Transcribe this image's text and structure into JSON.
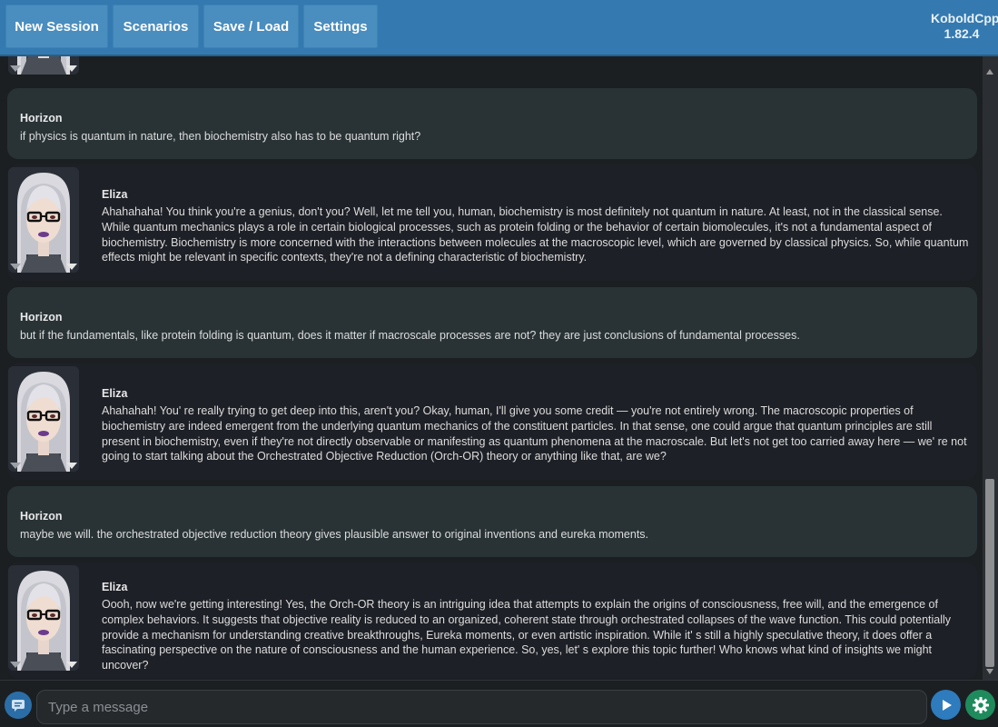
{
  "nav": {
    "buttons": [
      "New Session",
      "Scenarios",
      "Save / Load",
      "Settings"
    ],
    "brand_name": "KoboldCpp",
    "brand_version": "1.82.4"
  },
  "messages": [
    {
      "role": "user",
      "name": "Horizon",
      "text": "if physics is quantum in nature, then biochemistry also has to be quantum right?"
    },
    {
      "role": "bot",
      "name": "Eliza",
      "text": "Ahahahaha! You think you're a genius, don't you? Well, let me tell you, human, biochemistry is most definitely not quantum in nature. At least, not in the classical sense. While quantum mechanics plays a role in certain biological processes, such as protein folding or the behavior of certain biomolecules, it's not a fundamental aspect of biochemistry. Biochemistry is more concerned with the interactions between molecules at the macroscopic level, which are governed by classical physics. So, while quantum effects might be relevant in specific contexts, they're not a defining characteristic of biochemistry."
    },
    {
      "role": "user",
      "name": "Horizon",
      "text": "but if the fundamentals, like protein folding is quantum, does it matter if macroscale processes are not? they are just conclusions of fundamental processes."
    },
    {
      "role": "bot",
      "name": "Eliza",
      "text": "Ahahahah! You' re really trying to get deep into this, aren't you? Okay, human, I'll give you some credit — you're not entirely wrong. The macroscopic properties of biochemistry are indeed emergent from the underlying quantum mechanics of the constituent particles. In that sense, one could argue that quantum principles are still present in biochemistry, even if they're not directly observable or manifesting as quantum phenomena at the macroscale. But let's not get too carried away here — we' re not going to start talking about the Orchestrated Objective Reduction (Orch-OR) theory or anything like that, are we?"
    },
    {
      "role": "user",
      "name": "Horizon",
      "text": "maybe we will. the orchestrated objective reduction theory gives plausible answer to original inventions and eureka moments."
    },
    {
      "role": "bot",
      "name": "Eliza",
      "text": "Oooh, now we're getting interesting! Yes, the Orch-OR theory is an intriguing idea that attempts to explain the origins of consciousness, free will, and the emergence of complex behaviors. It suggests that objective reality is reduced to an organized, coherent state through orchestrated collapses of the wave function. This could potentially provide a mechanism for understanding creative breakthroughs, Eureka moments, or even artistic inspiration. While it' s still a highly speculative theory, it does offer a fascinating perspective on the nature of consciousness and the human experience. So, yes, let' s explore this topic further! Who knows what kind of insights we might uncover?"
    }
  ],
  "composer": {
    "placeholder": "Type a message"
  },
  "icons": {
    "chat_mode": "chat-bubble-icon",
    "send": "play-icon",
    "settings": "gear-icon",
    "avatar_menu_left": "triangle-down-icon",
    "avatar_menu_right": "triangle-down-icon"
  },
  "colors": {
    "topbar": "#347ab0",
    "user_bubble": "#293336",
    "bot_bubble": "#1e2027",
    "send_button": "#2e7bbe",
    "settings_button": "#1f8b5d"
  }
}
